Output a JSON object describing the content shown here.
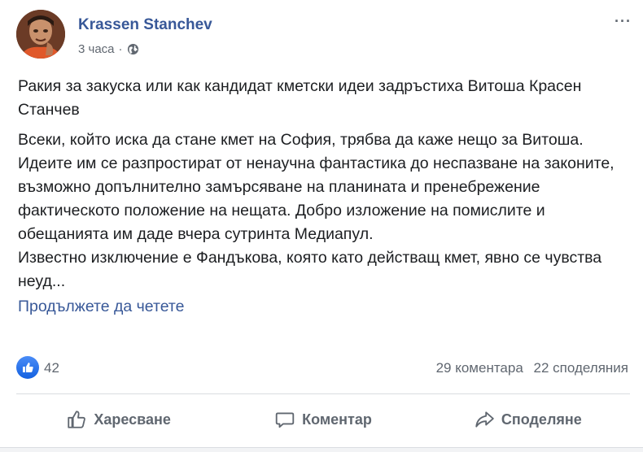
{
  "post": {
    "author": "Krassen Stanchev",
    "time": "3 часа",
    "separator": "·",
    "title": "Ракия за закуска или как кандидат кметски идеи задръстиха Витоша Красен Станчев",
    "body_para1": "Всеки, който иска да стане кмет на София, трябва да каже нещо за Витоша. Идеите им се разпростират от ненаучна фантастика до неспазване на законите, възможно допълнително замърсяване на планината и пренебрежение фактическото положение на нещата. Добро изложение на помислите и обещанията им даде вчера сутринта Медиапул.",
    "body_para2": "Известно изключение е Фандъкова, която като действащ кмет, явно се чувства неуд...",
    "see_more": "Продължете да четете",
    "more_label": "···"
  },
  "stats": {
    "likes": "42",
    "comments": "29 коментара",
    "shares": "22 споделяния"
  },
  "actions": {
    "like": "Харесване",
    "comment": "Коментар",
    "share": "Споделяне"
  },
  "colors": {
    "accent": "#385898",
    "muted": "#606770",
    "like_blue": "#1461e0"
  }
}
